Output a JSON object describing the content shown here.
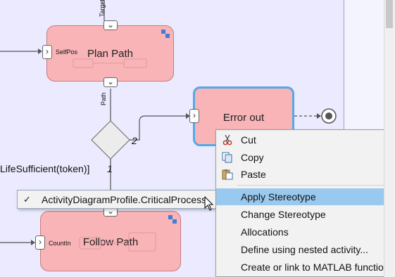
{
  "diagram": {
    "actions": [
      {
        "id": "plan-path",
        "name": "Plan Path",
        "pin": "SelfPos"
      },
      {
        "id": "error-out",
        "name": "Error out"
      },
      {
        "id": "follow-path",
        "name": "Follow Path",
        "pin": "CountIn"
      }
    ],
    "edge_labels": {
      "target": "Target",
      "path": "Path"
    },
    "guards": {
      "two": "2",
      "one": "1"
    },
    "guard_text": "LifeSufficient(token)]"
  },
  "context_menu": {
    "items": [
      {
        "label": "Cut",
        "icon": "scissors-icon",
        "highlighted": false
      },
      {
        "label": "Copy",
        "icon": "copy-icon",
        "highlighted": false
      },
      {
        "label": "Paste",
        "icon": "paste-icon",
        "highlighted": false
      },
      {
        "label": "Apply Stereotype",
        "highlighted": true
      },
      {
        "label": "Change Stereotype",
        "highlighted": false
      },
      {
        "label": "Allocations",
        "highlighted": false
      },
      {
        "label": "Define using nested activity...",
        "highlighted": false
      },
      {
        "label": "Create or link to MATLAB function...",
        "highlighted": false
      }
    ]
  },
  "stereotype_submenu": {
    "check": "✓",
    "option": "ActivityDiagramProfile.CriticalProcess"
  },
  "colors": {
    "canvas": "#ebeaff",
    "action_fill": "#f8b4b6",
    "selection_border": "#55a9e9",
    "menu_highlight": "#99c9ef"
  }
}
